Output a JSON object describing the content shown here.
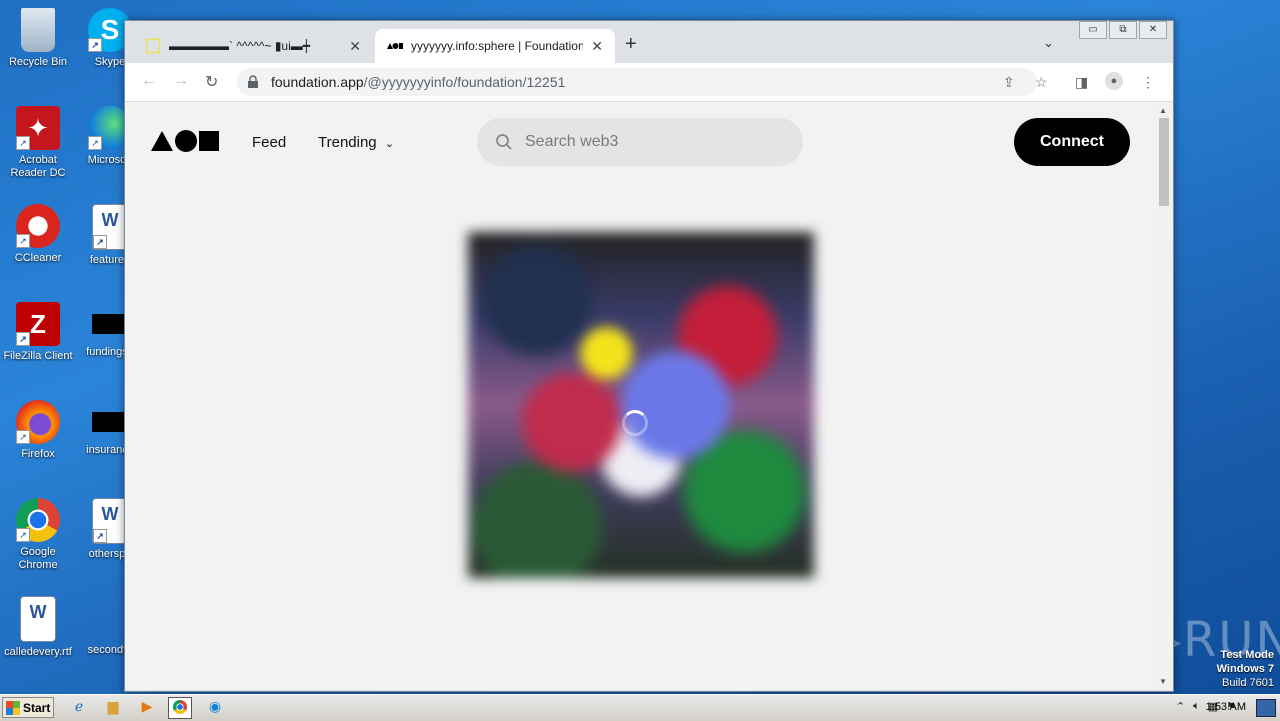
{
  "desktop": {
    "icons": [
      {
        "label": "Recycle Bin"
      },
      {
        "label": "Skype"
      },
      {
        "label": "Acrobat Reader DC"
      },
      {
        "label": "Microsoft"
      },
      {
        "label": "CCleaner"
      },
      {
        "label": "featured"
      },
      {
        "label": "FileZilla Client"
      },
      {
        "label": "fundingse"
      },
      {
        "label": "Firefox"
      },
      {
        "label": "insurance"
      },
      {
        "label": "Google Chrome"
      },
      {
        "label": "otherspo"
      },
      {
        "label": "calledevery.rtf"
      },
      {
        "label": "secondto"
      }
    ],
    "watermark": "ANY▷RUN",
    "test_mode": {
      "line1": "Test Mode",
      "line2": "Windows 7",
      "line3": "Build 7601"
    }
  },
  "browser": {
    "tabs": [
      {
        "title": "▬▬▬▬▬` ^^^^^~ ▮ui▬┿",
        "favicon": "blank-page-icon"
      },
      {
        "title": "yyyyyyy.info:sphere | Foundation",
        "favicon": "foundation-logo-icon"
      }
    ],
    "new_tab": "+",
    "tab_search": "⌄",
    "window_controls": {
      "minimize": "▭",
      "restore": "⧉",
      "close": "✕"
    },
    "nav": {
      "back": "←",
      "forward": "→",
      "reload": "↻"
    },
    "address": {
      "host": "foundation.app",
      "path": "/@yyyyyyyinfo/foundation/12251"
    }
  },
  "page": {
    "nav_links": {
      "feed": "Feed",
      "trending": "Trending"
    },
    "search": {
      "placeholder": "Search web3"
    },
    "connect_label": "Connect"
  },
  "taskbar": {
    "start_label": "Start",
    "clock": "1:53 AM"
  }
}
